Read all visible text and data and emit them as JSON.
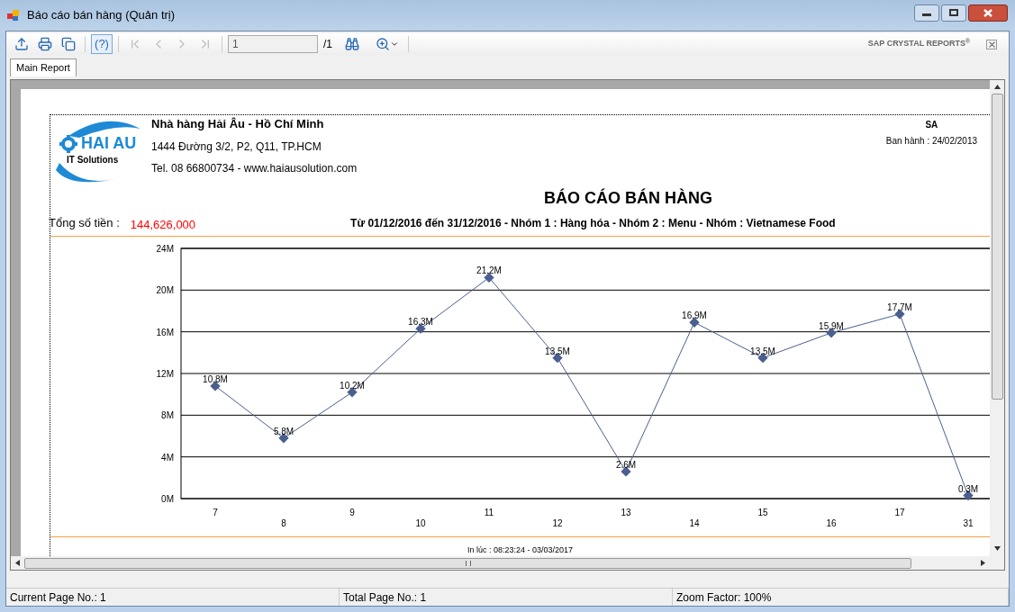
{
  "window": {
    "title": "Báo cáo bán hàng (Quản trị)"
  },
  "toolbar": {
    "buttons": [
      {
        "kind": "export",
        "disabled": false,
        "pressed": false
      },
      {
        "kind": "print",
        "disabled": false,
        "pressed": false
      },
      {
        "kind": "copy",
        "disabled": false,
        "pressed": false
      },
      {
        "kind": "help",
        "label": "(?)",
        "disabled": false,
        "pressed": true
      },
      {
        "kind": "first",
        "disabled": true,
        "pressed": false
      },
      {
        "kind": "prev",
        "disabled": true,
        "pressed": false
      },
      {
        "kind": "next",
        "disabled": true,
        "pressed": false
      },
      {
        "kind": "last",
        "disabled": true,
        "pressed": false
      }
    ],
    "page_field": {
      "value": "1"
    },
    "page_total": "/1",
    "brand": "SAP CRYSTAL REPORTS$^{®}$"
  },
  "tabs": [
    {
      "label": "Main Report",
      "selected": true
    }
  ],
  "report": {
    "logo": {
      "name": "HAI AU",
      "tagline": "IT Solutions"
    },
    "company": "Nhà hàng Hải Âu - Hồ Chí Minh",
    "address": "1444 Đường 3/2, P2, Q11, TP.HCM",
    "contact": "Tel. 08 66800734 - www.haiausolution.com",
    "code": "SA",
    "issued": "Ban hành : 24/02/2013",
    "title": "BÁO CÁO BÁN HÀNG",
    "total_label": "Tổng số tiền :",
    "total_value": "144,626,000",
    "subtitle": "Từ 01/12/2016 đến 31/12/2016 - Nhóm 1 : Hàng hóa - Nhóm 2 : Menu - Nhóm : Vietnamese Food",
    "chart_data": {
      "type": "line",
      "categories": [
        "7",
        "8",
        "9",
        "10",
        "11",
        "12",
        "13",
        "14",
        "15",
        "16",
        "17",
        "31"
      ],
      "series": [
        {
          "color": "#4a5f8f",
          "marker": "diamond",
          "values": [
            10.8,
            5.8,
            10.2,
            16.3,
            21.2,
            13.5,
            2.6,
            16.9,
            13.5,
            15.9,
            17.7,
            0.3
          ]
        }
      ],
      "grid": true,
      "ylim": [
        0,
        24
      ],
      "yticks": [
        {
          "value": 0,
          "label": "0M"
        },
        {
          "value": 4,
          "label": "4M"
        },
        {
          "value": 8,
          "label": "8M"
        },
        {
          "value": 12,
          "label": "12M"
        },
        {
          "value": 16,
          "label": "16M"
        },
        {
          "value": 20,
          "label": "20M"
        },
        {
          "value": 24,
          "label": "24M"
        }
      ],
      "value_labels": [
        "10.8M",
        "5.8M",
        "10.2M",
        "16.3M",
        "21.2M",
        "13.5M",
        "2.6M",
        "16.9M",
        "13.5M",
        "15.9M",
        "17.7M",
        "0.3M"
      ]
    },
    "printed": "In lúc : 08:23:24 - 03/03/2017"
  },
  "status_bar": [
    "Current Page No.: 1",
    "Total Page No.: 1",
    "Zoom Factor: 100%"
  ]
}
